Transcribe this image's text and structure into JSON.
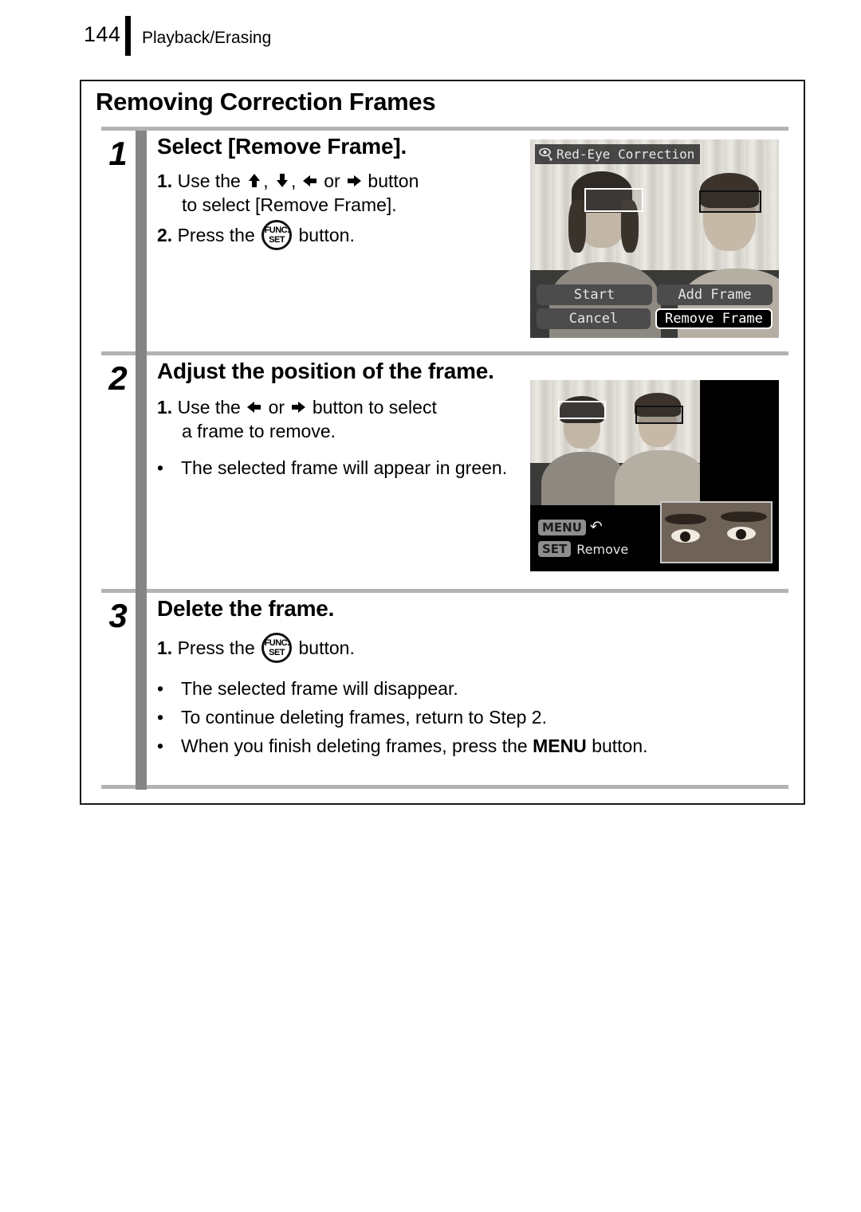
{
  "header": {
    "page_number": "144",
    "title": "Playback/Erasing"
  },
  "section": {
    "title": "Removing Correction Frames"
  },
  "steps": [
    {
      "number": "1",
      "heading": "Select [Remove Frame].",
      "items": [
        {
          "marker": "1.",
          "text_a": "Use the",
          "text_b": ",",
          "text_c": ",",
          "text_d": "or",
          "text_e": "button",
          "line2": "to select [Remove Frame]."
        },
        {
          "marker": "2.",
          "text_a": "Press the",
          "text_e": "button."
        }
      ]
    },
    {
      "number": "2",
      "heading": "Adjust the position of the frame.",
      "items": [
        {
          "marker": "1.",
          "text_a": "Use the",
          "text_d": "or",
          "text_e": "button to select",
          "line2": "a frame to remove."
        }
      ],
      "bullets": [
        {
          "dot": "•",
          "text": "The selected frame will appear in green."
        }
      ]
    },
    {
      "number": "3",
      "heading": "Delete the frame.",
      "items": [
        {
          "marker": "1.",
          "text_a": "Press the",
          "text_e": "button."
        }
      ],
      "bullets": [
        {
          "dot": "•",
          "text": "The selected frame will disappear."
        },
        {
          "dot": "•",
          "text": "To continue deleting frames, return to Step 2."
        },
        {
          "dot": "•",
          "text_pre": "When you finish deleting frames, press the",
          "text_bold": "MENU",
          "text_post": "button."
        }
      ]
    }
  ],
  "icons": {
    "arrow_up": "arrow-up-icon",
    "arrow_down": "arrow-down-icon",
    "arrow_left": "arrow-left-icon",
    "arrow_right": "arrow-right-icon",
    "func_set_top": "FUNC.",
    "func_set_bottom": "SET",
    "red_eye": "red-eye-correction-icon",
    "return_arrow": "↶"
  },
  "screenshot1": {
    "title": "Red-Eye Correction",
    "buttons": [
      {
        "label": "Start",
        "selected": false
      },
      {
        "label": "Add Frame",
        "selected": false
      },
      {
        "label": "Cancel",
        "selected": false
      },
      {
        "label": "Remove Frame",
        "selected": true
      }
    ]
  },
  "screenshot2": {
    "hints": [
      {
        "chip": "MENU",
        "label": ""
      },
      {
        "chip": "SET",
        "label": "Remove"
      }
    ]
  },
  "colors": {
    "spine_gray": "#858585",
    "rule_gray": "#b3b3b3",
    "border_black": "#1a1a1a",
    "lcd_button": "#4c4c4c",
    "lcd_selected": "#000000"
  }
}
